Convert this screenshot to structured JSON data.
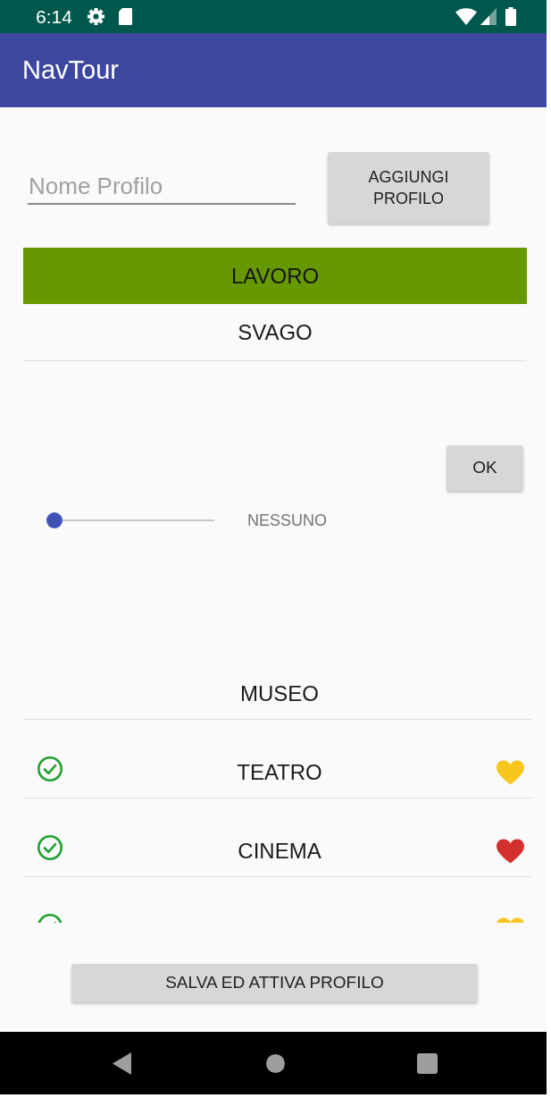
{
  "status_bar": {
    "time": "6:14"
  },
  "app_bar": {
    "title": "NavTour"
  },
  "profile_form": {
    "name_field": {
      "placeholder": "Nome Profilo"
    },
    "add_button": "AGGIUNGI PROFILO"
  },
  "profiles": [
    {
      "label": "LAVORO",
      "selected": true
    },
    {
      "label": "SVAGO",
      "selected": false
    }
  ],
  "ok_button": "OK",
  "slider": {
    "level": 0,
    "reading": "NESSUNO"
  },
  "places": [
    {
      "label": "MUSEO",
      "checked": false
    },
    {
      "label": "TEATRO",
      "checked": true,
      "color": "#f8c61e"
    },
    {
      "label": "CINEMA",
      "checked": true,
      "color": "#d32f2f"
    },
    {
      "checked": true,
      "color": "#f8c61e"
    }
  ],
  "save_button": "SALVA ED ATTIVA PROFILO"
}
